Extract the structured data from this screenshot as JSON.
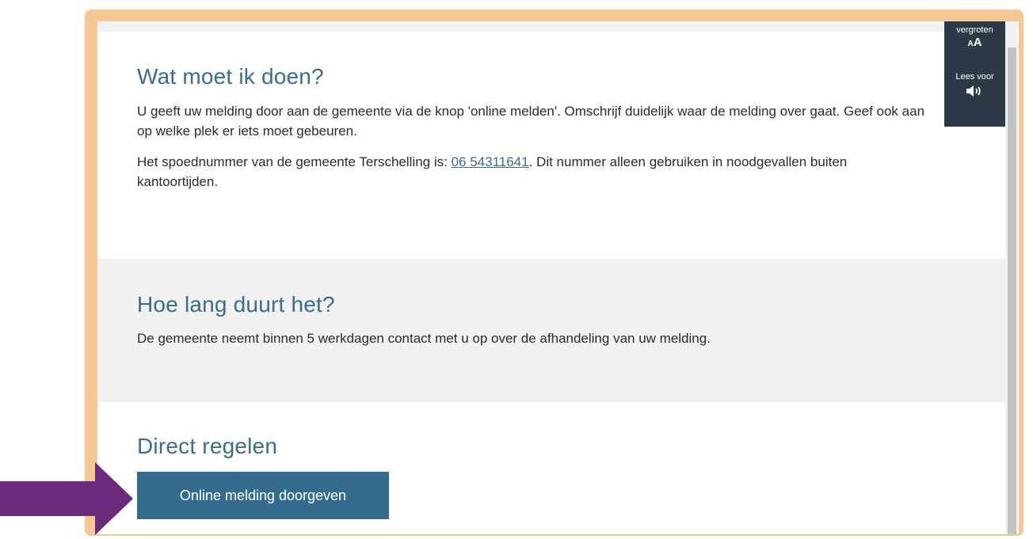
{
  "sections": {
    "what_to_do": {
      "heading": "Wat moet ik doen?",
      "paragraph1": "U geeft uw melding door aan de gemeente via de knop 'online melden'. Omschrijf duidelijk waar de melding over gaat. Geef ook aan op welke plek er iets moet gebeuren.",
      "paragraph2_before": "Het spoednummer van de gemeente Terschelling is: ",
      "phone_link": "06 54311641",
      "paragraph2_after": ". Dit nummer alleen gebruiken in noodgevallen buiten kantoortijden."
    },
    "how_long": {
      "heading": "Hoe lang duurt het?",
      "paragraph": "De gemeente neemt binnen 5 werkdagen contact met u op over de afhandeling van uw melding."
    },
    "direct": {
      "heading": "Direct regelen",
      "button_label": "Online melding doorgeven"
    }
  },
  "accessibility": {
    "enlarge_label": "vergroten",
    "enlarge_glyph": "A",
    "read_aloud_label": "Lees voor"
  },
  "colors": {
    "frame": "#f5c893",
    "heading": "#3a6c8f",
    "button": "#356b8e",
    "panel": "#2c3a47",
    "arrow": "#6c2a7d"
  },
  "icons": {
    "enlarge": "text-size-icon",
    "read_aloud": "speaker-icon",
    "annotation": "arrow-right-icon"
  }
}
